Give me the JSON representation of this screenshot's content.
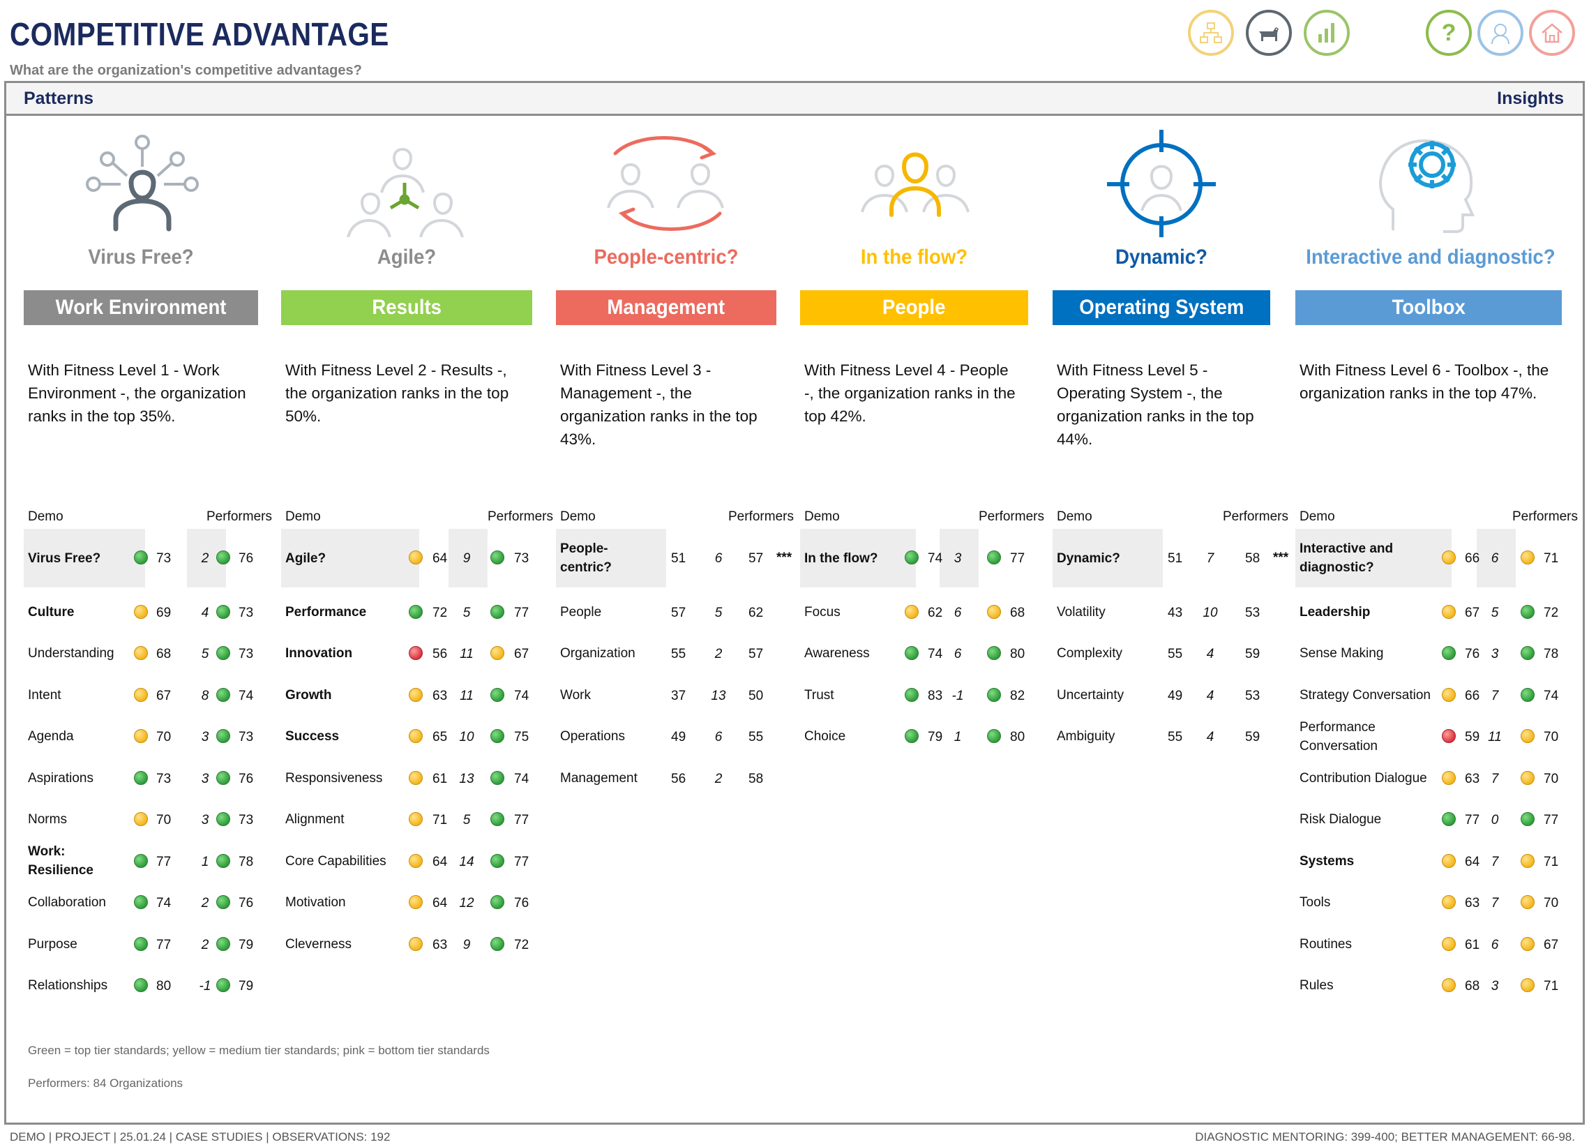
{
  "header": {
    "title": "COMPETITIVE ADVANTAGE",
    "subtitle": "What are the organization's competitive advantages?"
  },
  "nav_icons": [
    {
      "name": "structure-icon",
      "color": "#f3d27a"
    },
    {
      "name": "dog-icon",
      "color": "#5e6770"
    },
    {
      "name": "bar-chart-icon",
      "color": "#9cc468"
    },
    {
      "name": "help-icon",
      "label": "?",
      "color": "#8cbc4a"
    },
    {
      "name": "head-icon",
      "color": "#9cc3e6"
    },
    {
      "name": "home-icon",
      "color": "#f2a09a"
    }
  ],
  "bar": {
    "left": "Patterns",
    "right": "Insights"
  },
  "colors": {
    "work_environment": "#8c8c8c",
    "results": "#92d050",
    "management": "#ec6b5e",
    "people": "#ffc000",
    "operating_system": "#0070c0",
    "toolbox": "#5b9bd5"
  },
  "columns": [
    {
      "key": "work_environment",
      "question": "Virus Free?",
      "band": "Work Environment",
      "fitness": "With Fitness Level 1 - Work Environment -, the organization ranks in the top 35%.",
      "demo_label": "Demo",
      "performers_label": "Performers",
      "rows": [
        {
          "label": "Virus Free?",
          "bold": true,
          "shaded": true,
          "dot1": "green",
          "v1": "73",
          "d": "2",
          "dot2": "green",
          "v2": "76"
        },
        {
          "label": "Culture",
          "bold": true,
          "dot1": "yellow",
          "v1": "69",
          "d": "4",
          "dot2": "green",
          "v2": "73"
        },
        {
          "label": "Understanding",
          "dot1": "yellow",
          "v1": "68",
          "d": "5",
          "dot2": "green",
          "v2": "73"
        },
        {
          "label": "Intent",
          "dot1": "yellow",
          "v1": "67",
          "d": "8",
          "dot2": "green",
          "v2": "74"
        },
        {
          "label": "Agenda",
          "dot1": "yellow",
          "v1": "70",
          "d": "3",
          "dot2": "green",
          "v2": "73"
        },
        {
          "label": "Aspirations",
          "dot1": "green",
          "v1": "73",
          "d": "3",
          "dot2": "green",
          "v2": "76"
        },
        {
          "label": "Norms",
          "dot1": "yellow",
          "v1": "70",
          "d": "3",
          "dot2": "green",
          "v2": "73"
        },
        {
          "label": "Work: Resilience",
          "bold": true,
          "dot1": "green",
          "v1": "77",
          "d": "1",
          "dot2": "green",
          "v2": "78"
        },
        {
          "label": "Collaboration",
          "dot1": "green",
          "v1": "74",
          "d": "2",
          "dot2": "green",
          "v2": "76"
        },
        {
          "label": "Purpose",
          "dot1": "green",
          "v1": "77",
          "d": "2",
          "dot2": "green",
          "v2": "79"
        },
        {
          "label": "Relationships",
          "dot1": "green",
          "v1": "80",
          "d": "-1",
          "dot2": "green",
          "v2": "79"
        }
      ]
    },
    {
      "key": "results",
      "question": "Agile?",
      "band": "Results",
      "fitness": "With Fitness Level 2 - Results -, the organization ranks in the top 50%.",
      "demo_label": "Demo",
      "performers_label": "Performers",
      "rows": [
        {
          "label": "Agile?",
          "bold": true,
          "shaded": true,
          "dot1": "yellow",
          "v1": "64",
          "d": "9",
          "dot2": "green",
          "v2": "73"
        },
        {
          "label": "Performance",
          "bold": true,
          "dot1": "green",
          "v1": "72",
          "d": "5",
          "dot2": "green",
          "v2": "77"
        },
        {
          "label": "Innovation",
          "bold": true,
          "dot1": "red",
          "v1": "56",
          "d": "11",
          "dot2": "yellow",
          "v2": "67"
        },
        {
          "label": "Growth",
          "bold": true,
          "dot1": "yellow",
          "v1": "63",
          "d": "11",
          "dot2": "green",
          "v2": "74"
        },
        {
          "label": "Success",
          "bold": true,
          "dot1": "yellow",
          "v1": "65",
          "d": "10",
          "dot2": "green",
          "v2": "75"
        },
        {
          "label": "Responsiveness",
          "dot1": "yellow",
          "v1": "61",
          "d": "13",
          "dot2": "green",
          "v2": "74"
        },
        {
          "label": "Alignment",
          "dot1": "yellow",
          "v1": "71",
          "d": "5",
          "dot2": "green",
          "v2": "77"
        },
        {
          "label": "Core Capabilities",
          "dot1": "yellow",
          "v1": "64",
          "d": "14",
          "dot2": "green",
          "v2": "77"
        },
        {
          "label": "Motivation",
          "dot1": "yellow",
          "v1": "64",
          "d": "12",
          "dot2": "green",
          "v2": "76"
        },
        {
          "label": "Cleverness",
          "dot1": "yellow",
          "v1": "63",
          "d": "9",
          "dot2": "green",
          "v2": "72"
        }
      ]
    },
    {
      "key": "management",
      "question": "People-centric?",
      "band": "Management",
      "fitness": "With Fitness Level 3 - Management -, the organization ranks in the top 43%.",
      "demo_label": "Demo",
      "performers_label": "Performers",
      "rows": [
        {
          "label": "People-centric?",
          "bold": true,
          "shaded": true,
          "v1": "51",
          "d": "6",
          "v2": "57",
          "stars": "***"
        },
        {
          "label": "People",
          "v1": "57",
          "d": "5",
          "v2": "62"
        },
        {
          "label": "Organization",
          "v1": "55",
          "d": "2",
          "v2": "57"
        },
        {
          "label": "Work",
          "v1": "37",
          "d": "13",
          "v2": "50"
        },
        {
          "label": "Operations",
          "v1": "49",
          "d": "6",
          "v2": "55"
        },
        {
          "label": "Management",
          "v1": "56",
          "d": "2",
          "v2": "58"
        }
      ]
    },
    {
      "key": "people",
      "question": "In the flow?",
      "band": "People",
      "fitness": "With Fitness Level 4 - People -, the organization ranks in the top 42%.",
      "demo_label": "Demo",
      "performers_label": "Performers",
      "rows": [
        {
          "label": "In the flow?",
          "bold": true,
          "shaded": true,
          "dot1": "green",
          "v1": "74",
          "d": "3",
          "dot2": "green",
          "v2": "77"
        },
        {
          "label": "Focus",
          "dot1": "yellow",
          "v1": "62",
          "d": "6",
          "dot2": "yellow",
          "v2": "68"
        },
        {
          "label": "Awareness",
          "dot1": "green",
          "v1": "74",
          "d": "6",
          "dot2": "green",
          "v2": "80"
        },
        {
          "label": "Trust",
          "dot1": "green",
          "v1": "83",
          "d": "-1",
          "dot2": "green",
          "v2": "82"
        },
        {
          "label": "Choice",
          "dot1": "green",
          "v1": "79",
          "d": "1",
          "dot2": "green",
          "v2": "80"
        }
      ]
    },
    {
      "key": "operating_system",
      "question": "Dynamic?",
      "band": "Operating System",
      "fitness": "With Fitness Level 5 - Operating System -, the organization ranks in the top 44%.",
      "demo_label": "Demo",
      "performers_label": "Performers",
      "rows": [
        {
          "label": "Dynamic?",
          "bold": true,
          "shaded": true,
          "v1": "51",
          "d": "7",
          "v2": "58",
          "stars": "***"
        },
        {
          "label": "Volatility",
          "v1": "43",
          "d": "10",
          "v2": "53"
        },
        {
          "label": "Complexity",
          "v1": "55",
          "d": "4",
          "v2": "59"
        },
        {
          "label": "Uncertainty",
          "v1": "49",
          "d": "4",
          "v2": "53"
        },
        {
          "label": "Ambiguity",
          "v1": "55",
          "d": "4",
          "v2": "59"
        }
      ]
    },
    {
      "key": "toolbox",
      "question": "Interactive and diagnostic?",
      "band": "Toolbox",
      "fitness": "With Fitness Level 6 - Toolbox -, the organization ranks in the top 47%.",
      "demo_label": "Demo",
      "performers_label": "Performers",
      "rows": [
        {
          "label": "Interactive and diagnostic?",
          "bold": true,
          "shaded": true,
          "dot1": "yellow",
          "v1": "66",
          "d": "6",
          "dot2": "yellow",
          "v2": "71"
        },
        {
          "label": "Leadership",
          "bold": true,
          "dot1": "yellow",
          "v1": "67",
          "d": "5",
          "dot2": "green",
          "v2": "72"
        },
        {
          "label": "Sense Making",
          "dot1": "green",
          "v1": "76",
          "d": "3",
          "dot2": "green",
          "v2": "78"
        },
        {
          "label": "Strategy Conversation",
          "dot1": "yellow",
          "v1": "66",
          "d": "7",
          "dot2": "green",
          "v2": "74"
        },
        {
          "label": "Performance Conversation",
          "dot1": "red",
          "v1": "59",
          "d": "11",
          "dot2": "yellow",
          "v2": "70"
        },
        {
          "label": "Contribution Dialogue",
          "dot1": "yellow",
          "v1": "63",
          "d": "7",
          "dot2": "yellow",
          "v2": "70"
        },
        {
          "label": "Risk Dialogue",
          "dot1": "green",
          "v1": "77",
          "d": "0",
          "dot2": "green",
          "v2": "77"
        },
        {
          "label": "Systems",
          "bold": true,
          "dot1": "yellow",
          "v1": "64",
          "d": "7",
          "dot2": "yellow",
          "v2": "71"
        },
        {
          "label": "Tools",
          "dot1": "yellow",
          "v1": "63",
          "d": "7",
          "dot2": "yellow",
          "v2": "70"
        },
        {
          "label": "Routines",
          "dot1": "yellow",
          "v1": "61",
          "d": "6",
          "dot2": "yellow",
          "v2": "67"
        },
        {
          "label": "Rules",
          "dot1": "yellow",
          "v1": "68",
          "d": "3",
          "dot2": "yellow",
          "v2": "71"
        }
      ]
    }
  ],
  "legend": "Green = top tier standards; yellow = medium tier standards; pink = bottom tier standards",
  "performers_note": "Performers: 84 Organizations",
  "footer": {
    "left": "DEMO  |  PROJECT  |  25.01.24  |  CASE STUDIES  |  OBSERVATIONS: 192",
    "right": "DIAGNOSTIC MENTORING: 399-400; BETTER MANAGEMENT: 66-98."
  }
}
